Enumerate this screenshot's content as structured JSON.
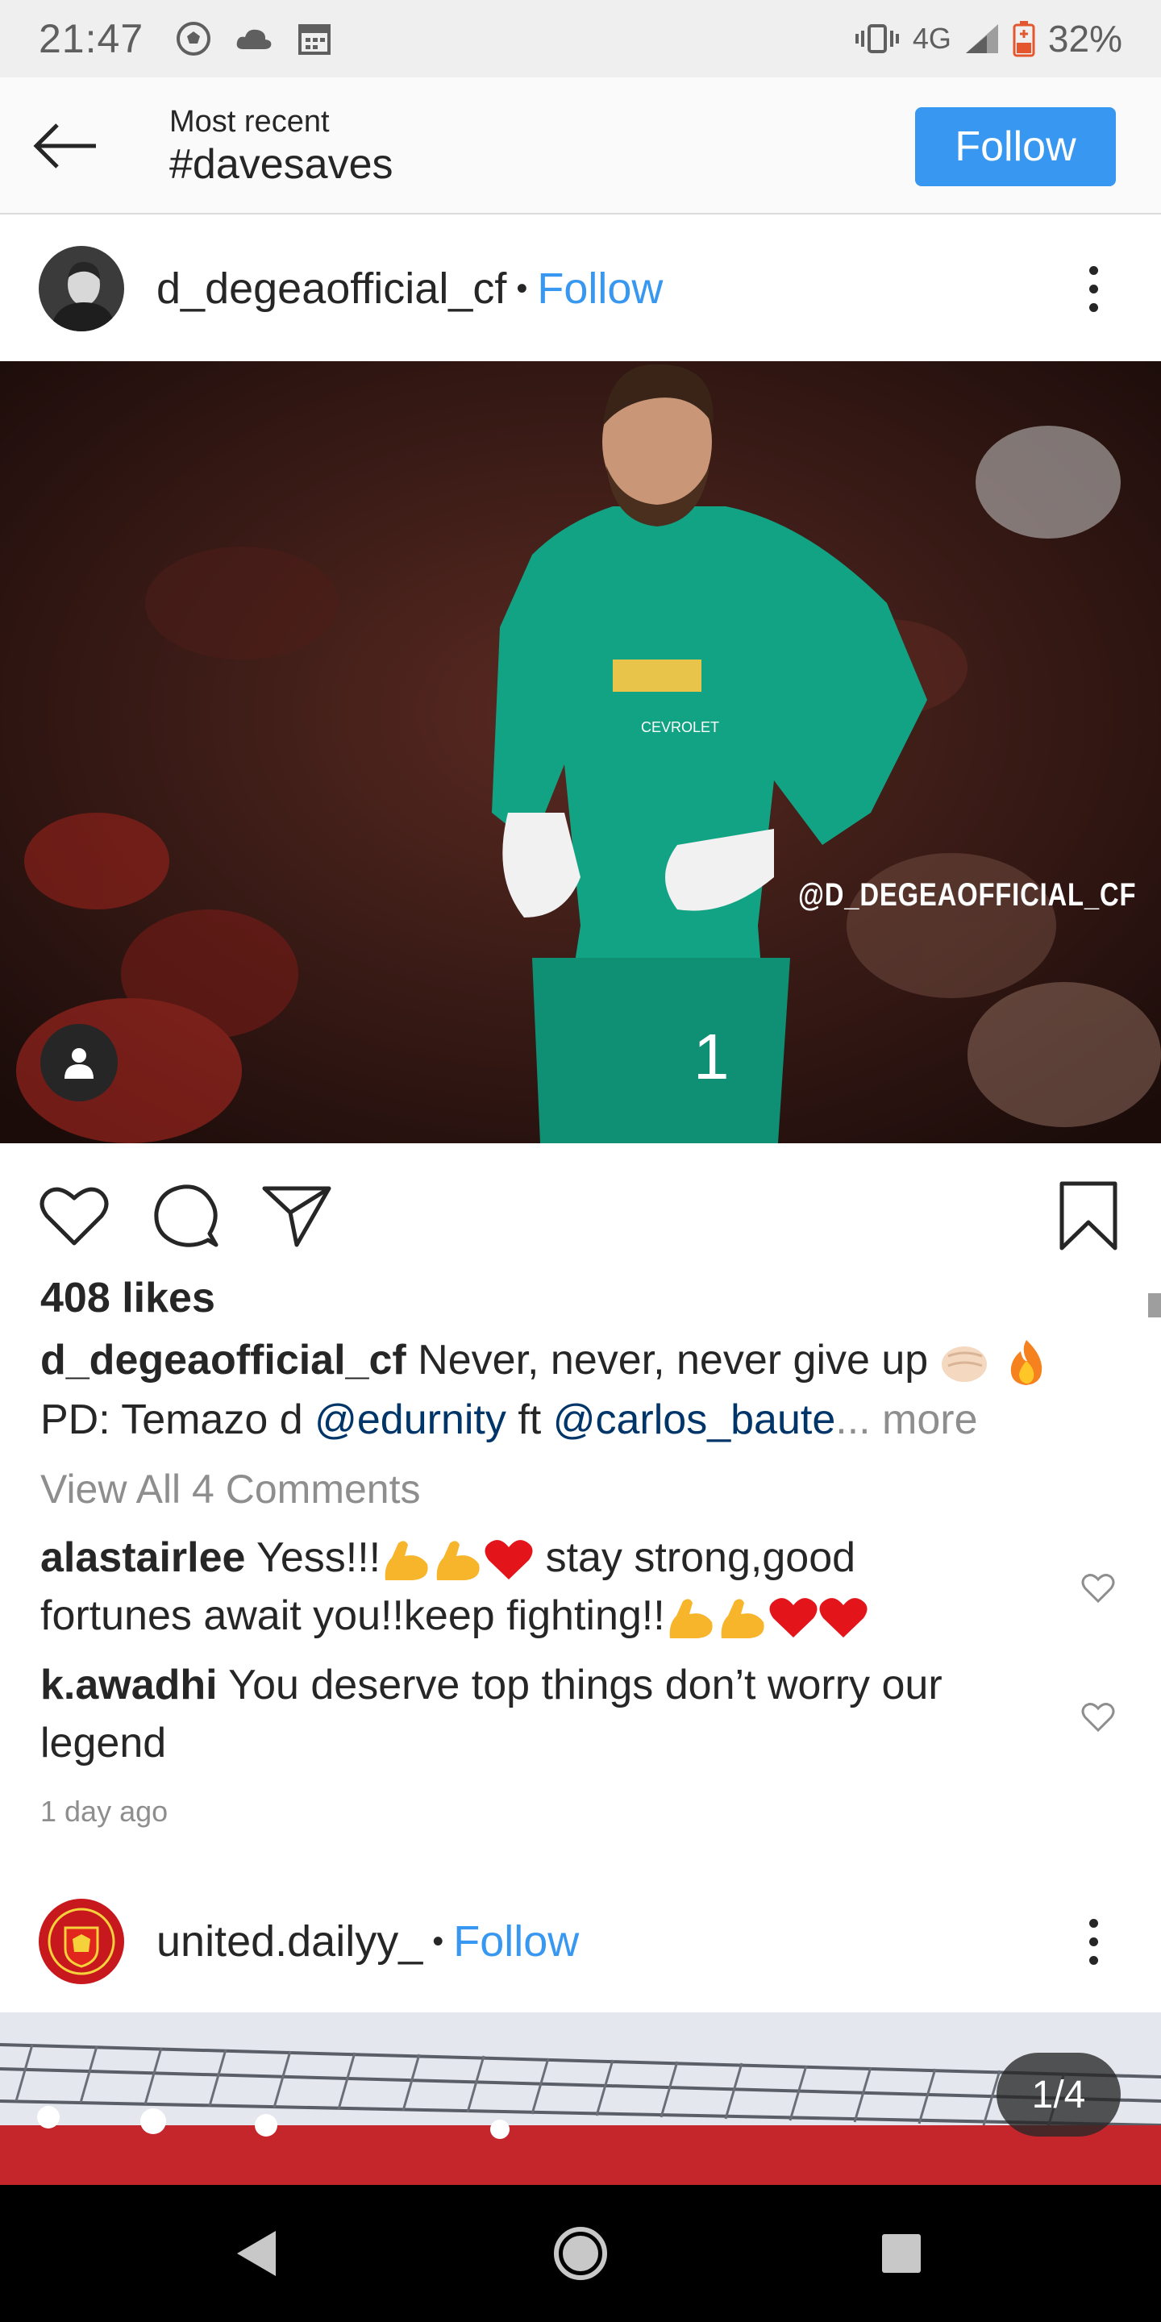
{
  "status": {
    "time": "21:47",
    "network": "4G",
    "battery": "32%"
  },
  "header": {
    "subtitle": "Most recent",
    "hashtag": "#davesaves",
    "follow_label": "Follow"
  },
  "post1": {
    "username": "d_degeaofficial_cf",
    "separator": "•",
    "follow_label": "Follow",
    "image_watermark": "@D_DEGEAOFFICIAL_CF",
    "likes": "408 likes",
    "caption_user": "d_degeaofficial_cf",
    "caption_text": "Never, never, never give up",
    "caption_line2_prefix": "PD: Temazo d",
    "mention1": "@edurnity",
    "caption_ft": "ft",
    "mention2": "@carlos_baute",
    "ellipsis": "...",
    "more_label": "more",
    "view_all_comments": "View All 4 Comments",
    "comments": [
      {
        "user": "alastairlee",
        "text_a": "Yess!!!",
        "text_b": "stay strong,good",
        "text_c": "fortunes await you!!keep fighting!!"
      },
      {
        "user": "k.awadhi",
        "text": "You deserve top things don’t worry our legend"
      }
    ],
    "timestamp": "1 day ago"
  },
  "post2": {
    "username": "united.dailyy_",
    "separator": "•",
    "follow_label": "Follow",
    "page_counter": "1/4"
  },
  "icons": {
    "back": "arrow-left-icon",
    "like": "heart-icon",
    "comment": "speech-bubble-icon",
    "share": "paper-plane-icon",
    "save": "bookmark-icon",
    "tag": "person-tag-icon"
  },
  "colors": {
    "accent": "#3897f0",
    "mention": "#003569",
    "muted": "#8e8e8e",
    "text": "#262626"
  }
}
